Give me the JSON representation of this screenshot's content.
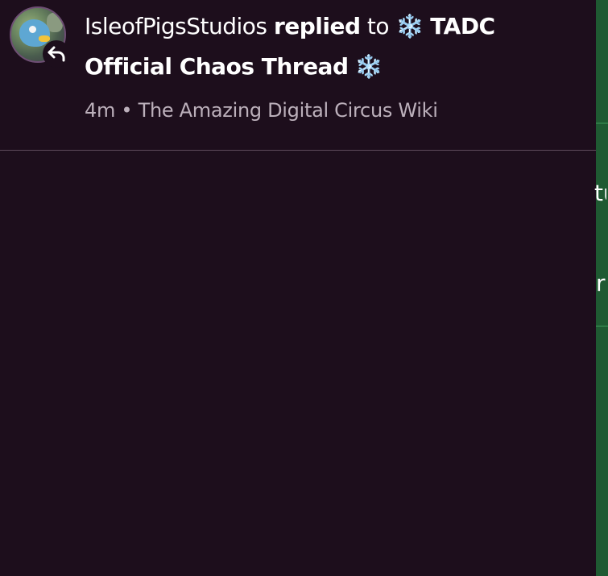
{
  "notification": {
    "username": "IsleofPigsStudios",
    "action": "replied",
    "connector": "to",
    "thread_prefix_emoji": "❄️",
    "thread_title_part1": "TADC",
    "thread_title_part2": "Official Chaos Thread",
    "thread_suffix_emoji": "❄️",
    "time_ago": "4m",
    "separator": "•",
    "wiki_name": "The Amazing Digital Circus Wiki"
  },
  "icons": {
    "reply_badge": "reply-arrow-icon",
    "avatar": "user-avatar"
  },
  "colors": {
    "background": "#1d0e1c",
    "divider": "#5d4a5b",
    "text_primary": "#ffffff",
    "text_secondary": "#bcb0bb",
    "side_panel": "#1f5a32"
  },
  "side_panel": {
    "fragment_1": "tu",
    "fragment_2": "r"
  }
}
